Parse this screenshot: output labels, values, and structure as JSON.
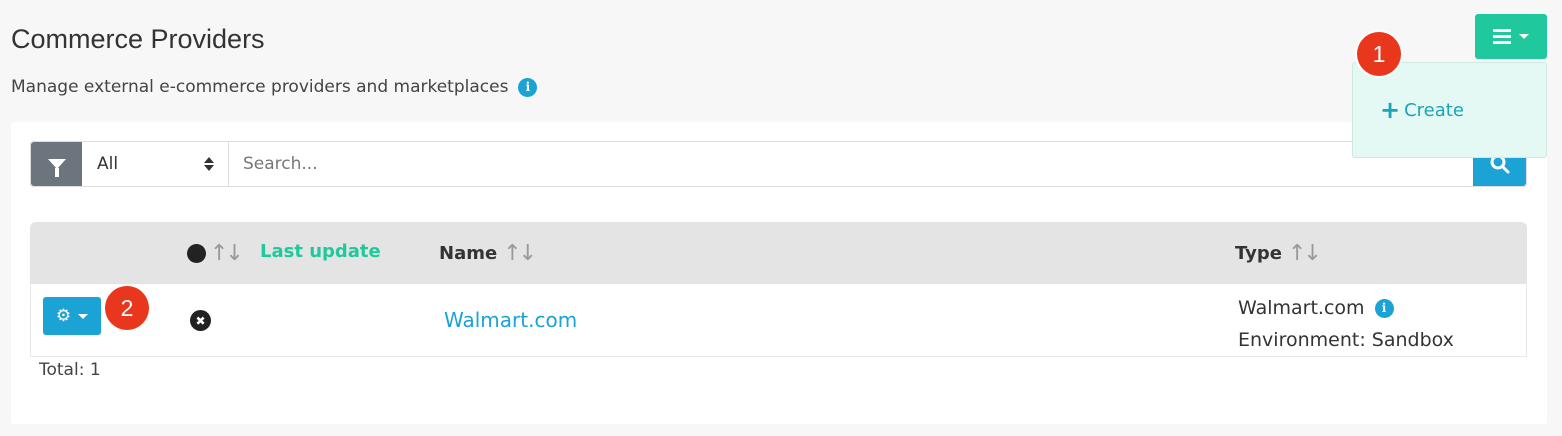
{
  "header": {
    "title": "Commerce Providers",
    "subtitle": "Manage external e-commerce providers and marketplaces",
    "info_icon": "i"
  },
  "menu": {
    "icon": "hamburger-icon",
    "dropdown": {
      "create_label": "Create",
      "plus": "+"
    }
  },
  "badges": {
    "one": "1",
    "two": "2"
  },
  "filter": {
    "select_value": "All",
    "search_placeholder": "Search..."
  },
  "table": {
    "columns": {
      "last_update": "Last update",
      "name": "Name",
      "type": "Type"
    },
    "rows": [
      {
        "status_icon": "✖",
        "name": "Walmart.com",
        "type": "Walmart.com",
        "environment": "Environment: Sandbox"
      }
    ]
  },
  "footer": {
    "total": "Total: 1"
  },
  "colors": {
    "accent": "#1fc89d",
    "primary": "#1ba3d6",
    "badge": "#e8371c",
    "filter": "#6c757d"
  }
}
